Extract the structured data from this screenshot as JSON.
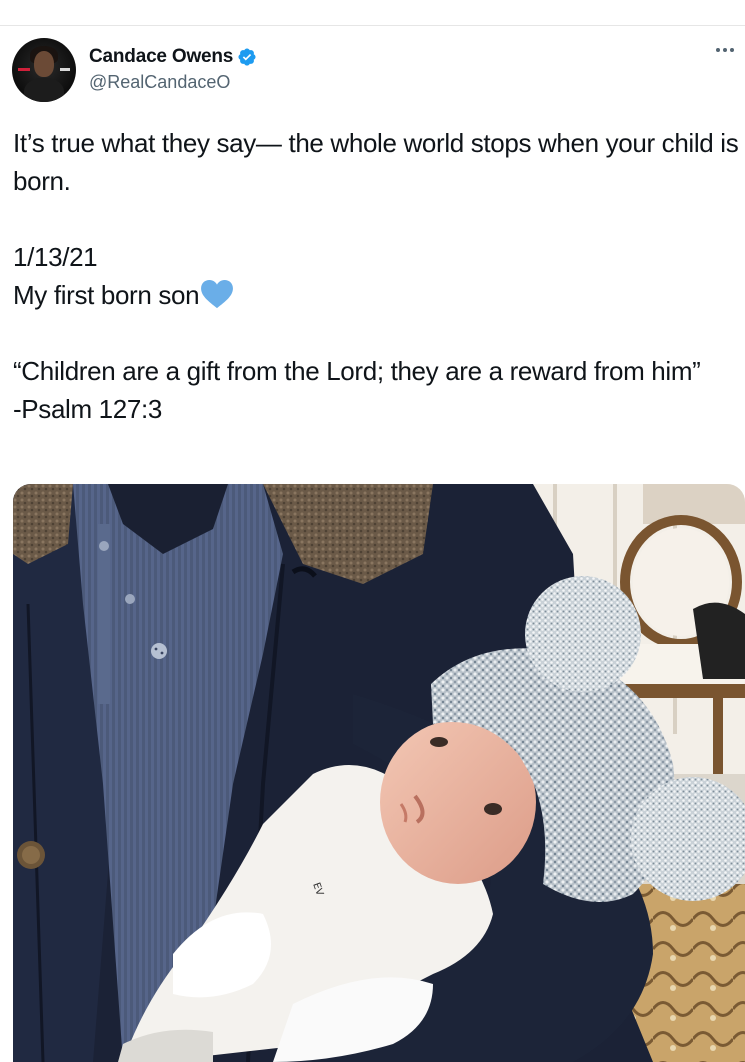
{
  "tweet": {
    "author": {
      "display_name": "Candace Owens",
      "handle": "@RealCandaceO",
      "verified": true,
      "avatar_icon": "profile-avatar"
    },
    "more_icon": "more-options-icon",
    "text": {
      "line1": "It’s true what they say— the whole world stops when your child is born.",
      "date": "1/13/21",
      "son": "My first born son",
      "heart_icon": "blue-heart-emoji",
      "quote": "“Children are a gift from the Lord; they are a reward from him”",
      "citation": "-Psalm 127:3"
    },
    "media": {
      "type": "photo"
    }
  },
  "colors": {
    "verified_blue": "#1d9bf0",
    "heart_blue": "#6aaee8",
    "secondary_text": "#536471",
    "primary_text": "#0f1419"
  }
}
